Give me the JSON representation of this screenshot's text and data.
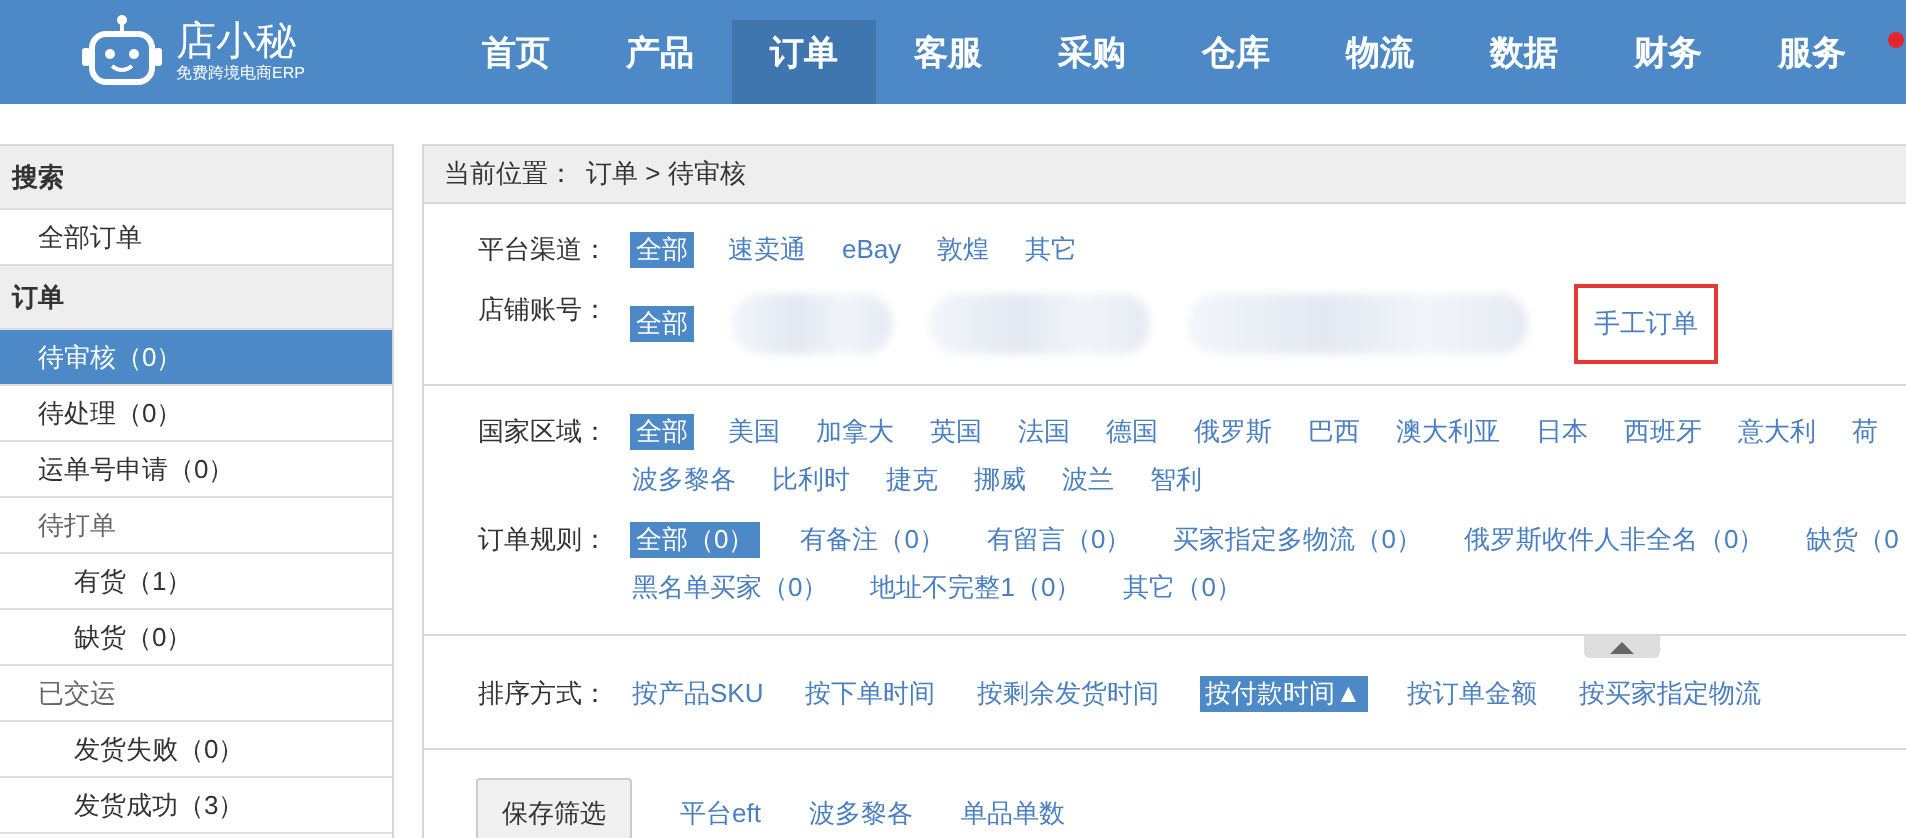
{
  "header": {
    "logo": {
      "name": "店小秘",
      "tagline": "免费跨境电商ERP"
    },
    "nav": [
      {
        "label": "首页",
        "selected": false,
        "dot": false
      },
      {
        "label": "产品",
        "selected": false,
        "dot": false
      },
      {
        "label": "订单",
        "selected": true,
        "dot": false
      },
      {
        "label": "客服",
        "selected": false,
        "dot": false
      },
      {
        "label": "采购",
        "selected": false,
        "dot": false
      },
      {
        "label": "仓库",
        "selected": false,
        "dot": false
      },
      {
        "label": "物流",
        "selected": false,
        "dot": false
      },
      {
        "label": "数据",
        "selected": false,
        "dot": false
      },
      {
        "label": "财务",
        "selected": false,
        "dot": false
      },
      {
        "label": "服务",
        "selected": false,
        "dot": true
      }
    ]
  },
  "sidebar": {
    "sections": [
      {
        "title": "搜索",
        "items": [
          {
            "label": "全部订单",
            "selected": false
          }
        ]
      },
      {
        "title": "订单",
        "items": [
          {
            "label": "待审核",
            "count": "（0）",
            "selected": true
          },
          {
            "label": "待处理",
            "count": "（0）",
            "selected": false
          },
          {
            "label": "运单号申请",
            "count": "（0）",
            "selected": false
          },
          {
            "label": "待打单",
            "selected": false,
            "children": [
              {
                "label": "有货",
                "count": "（1）",
                "selected": false
              },
              {
                "label": "缺货",
                "count": "（0）",
                "selected": false
              }
            ]
          },
          {
            "label": "已交运",
            "selected": false,
            "children": [
              {
                "label": "发货失败",
                "count": "（0）",
                "selected": false
              },
              {
                "label": "发货成功",
                "count": "（3）",
                "selected": false
              }
            ]
          }
        ]
      }
    ]
  },
  "breadcrumb": {
    "label": "当前位置：",
    "path": "订单 > 待审核"
  },
  "filter_sections": [
    {
      "rows": [
        {
          "label": "平台渠道：",
          "options": [
            {
              "text": "全部",
              "selected": true
            },
            {
              "text": "速卖通",
              "selected": false
            },
            {
              "text": "eBay",
              "selected": false
            },
            {
              "text": "敦煌",
              "selected": false
            },
            {
              "text": "其它",
              "selected": false
            }
          ]
        },
        {
          "label": "店铺账号：",
          "options": [
            {
              "text": "全部",
              "selected": true
            },
            {
              "kind": "blurred"
            },
            {
              "kind": "blurred"
            },
            {
              "kind": "blurred"
            },
            {
              "text": "手工订单",
              "selected": false,
              "highlighted": true
            }
          ]
        }
      ]
    },
    {
      "rows": [
        {
          "label": "国家区域：",
          "options": [
            {
              "text": "全部",
              "selected": true
            },
            {
              "text": "美国",
              "selected": false
            },
            {
              "text": "加拿大",
              "selected": false
            },
            {
              "text": "英国",
              "selected": false
            },
            {
              "text": "法国",
              "selected": false
            },
            {
              "text": "德国",
              "selected": false
            },
            {
              "text": "俄罗斯",
              "selected": false
            },
            {
              "text": "巴西",
              "selected": false
            },
            {
              "text": "澳大利亚",
              "selected": false
            },
            {
              "text": "日本",
              "selected": false
            },
            {
              "text": "西班牙",
              "selected": false
            },
            {
              "text": "意大利",
              "selected": false
            },
            {
              "text": "荷",
              "selected": false
            },
            {
              "text": "波多黎各",
              "selected": false
            },
            {
              "text": "比利时",
              "selected": false
            },
            {
              "text": "捷克",
              "selected": false
            },
            {
              "text": "挪威",
              "selected": false
            },
            {
              "text": "波兰",
              "selected": false
            },
            {
              "text": "智利",
              "selected": false
            }
          ]
        },
        {
          "label": "订单规则：",
          "options": [
            {
              "text": "全部（0）",
              "selected": true
            },
            {
              "text": "有备注（0）",
              "selected": false
            },
            {
              "text": "有留言（0）",
              "selected": false
            },
            {
              "text": "买家指定多物流（0）",
              "selected": false
            },
            {
              "text": "俄罗斯收件人非全名（0）",
              "selected": false
            },
            {
              "text": "缺货（0",
              "selected": false
            },
            {
              "text": "黑名单买家（0）",
              "selected": false
            },
            {
              "text": "地址不完整1（0）",
              "selected": false
            },
            {
              "text": "其它（0）",
              "selected": false
            }
          ]
        }
      ]
    }
  ],
  "sort": {
    "label": "排序方式：",
    "options": [
      {
        "text": "按产品SKU",
        "selected": false
      },
      {
        "text": "按下单时间",
        "selected": false
      },
      {
        "text": "按剩余发货时间",
        "selected": false
      },
      {
        "text": "按付款时间",
        "selected": true,
        "arrow": "▲"
      },
      {
        "text": "按订单金额",
        "selected": false
      },
      {
        "text": "按买家指定物流",
        "selected": false
      }
    ]
  },
  "saved": {
    "button": "保存筛选",
    "filters": [
      "平台eft",
      "波多黎各",
      "单品单数"
    ]
  }
}
